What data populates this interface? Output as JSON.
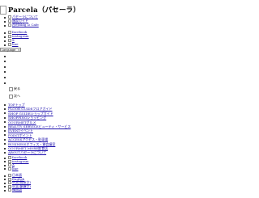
{
  "header": {
    "logo_alt": "Parcela（パセーラ）"
  },
  "top_nav": [
    "パセーラについて",
    "施設ガイド",
    "西村Bldg & Cafe"
  ],
  "social": [
    "facebook",
    "instagram",
    "X",
    "line"
  ],
  "language_select": {
    "value": "Language"
  },
  "carousel": {
    "prev": "戻る",
    "next": "次へ"
  },
  "main_nav": [
    "TOPトップ",
    "FLOOR GUIDEフロアガイド",
    "SHOP GUIDEショップガイド",
    "SHOPPINGショッピング",
    "GOURMETグルメ",
    "BEAUTY SERVICEビューティ・サービス",
    "EVENTイベント",
    "POINTポイント",
    "ACCESSアクセス・駐車場",
    "BUSINESSオフィス・貸会議室",
    "GOURMET MORE飲食店",
    "ABOUTパセーラについて"
  ],
  "footer_social": [
    "facebook",
    "instagram",
    "X",
    "line"
  ],
  "languages": [
    "日本語",
    "English",
    "中文(简体字)",
    "中文(繁體字)",
    "韓国語"
  ]
}
